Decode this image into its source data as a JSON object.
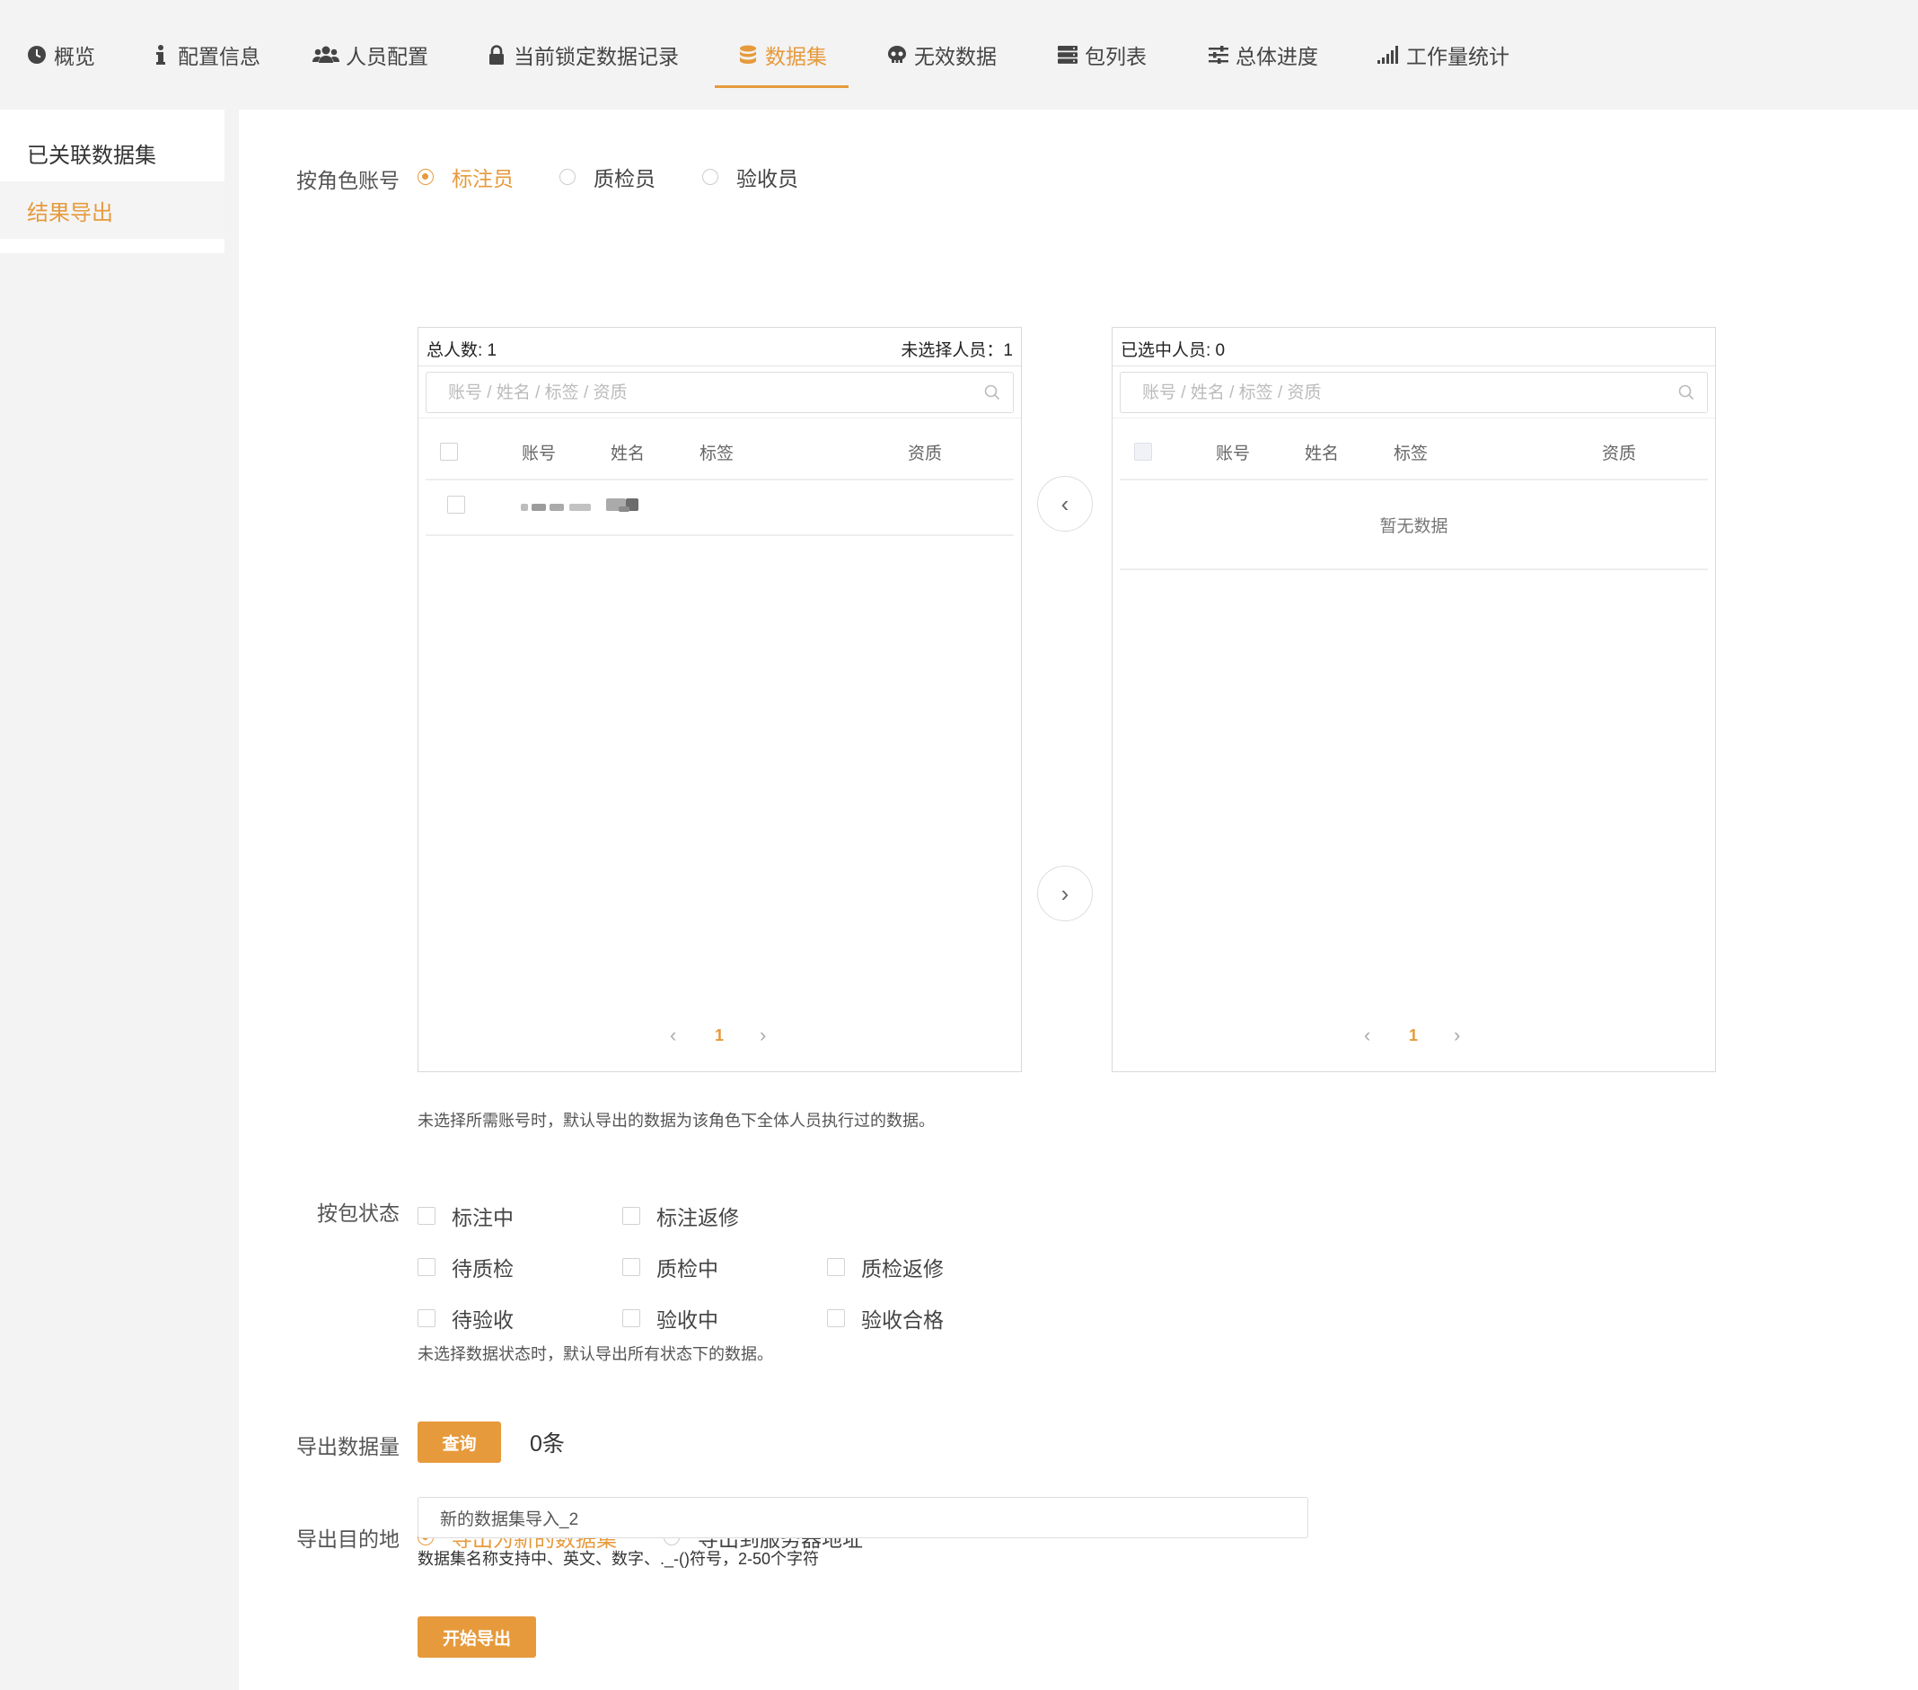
{
  "nav": {
    "tabs": [
      {
        "label": "概览",
        "icon": "clock-icon"
      },
      {
        "label": "配置信息",
        "icon": "info-icon"
      },
      {
        "label": "人员配置",
        "icon": "users-icon"
      },
      {
        "label": "当前锁定数据记录",
        "icon": "lock-icon"
      },
      {
        "label": "数据集",
        "icon": "database-icon",
        "active": true
      },
      {
        "label": "无效数据",
        "icon": "skull-icon"
      },
      {
        "label": "包列表",
        "icon": "server-list-icon"
      },
      {
        "label": "总体进度",
        "icon": "sliders-icon"
      },
      {
        "label": "工作量统计",
        "icon": "signal-bars-icon"
      }
    ]
  },
  "sidebar": {
    "items": [
      {
        "label": "已关联数据集",
        "active": false
      },
      {
        "label": "结果导出",
        "active": true
      }
    ]
  },
  "role_filter": {
    "label": "按角色账号",
    "options": [
      {
        "label": "标注员",
        "selected": true
      },
      {
        "label": "质检员",
        "selected": false
      },
      {
        "label": "验收员",
        "selected": false
      }
    ]
  },
  "left_panel": {
    "total": "总人数: 1",
    "unselected": "未选择人员：1",
    "search_placeholder": "账号 / 姓名 / 标签 / 资质",
    "columns": [
      "账号",
      "姓名",
      "标签",
      "资质"
    ],
    "rows_count": 1,
    "page": "1"
  },
  "right_panel": {
    "selected": "已选中人员: 0",
    "search_placeholder": "账号 / 姓名 / 标签 / 资质",
    "columns": [
      "账号",
      "姓名",
      "标签",
      "资质"
    ],
    "empty": "暂无数据",
    "page": "1"
  },
  "transfer": {
    "left_arrow": "‹",
    "right_arrow": "›"
  },
  "role_note": "未选择所需账号时，默认导出的数据为该角色下全体人员执行过的数据。",
  "status_filter": {
    "label": "按包状态",
    "rows": [
      [
        "标注中",
        "标注返修"
      ],
      [
        "待质检",
        "质检中",
        "质检返修"
      ],
      [
        "待验收",
        "验收中",
        "验收合格"
      ]
    ],
    "note": "未选择数据状态时，默认导出所有状态下的数据。"
  },
  "export_count": {
    "label": "导出数据量",
    "button": "查询",
    "value": "0条"
  },
  "destination": {
    "label": "导出目的地",
    "options": [
      {
        "label": "导出为新的数据集",
        "selected": true
      },
      {
        "label": "导出到服务器地址",
        "selected": false
      }
    ],
    "input_value": "新的数据集导入_2",
    "hint": "数据集名称支持中、英文、数字、._-()符号，2-50个字符"
  },
  "start_button": "开始导出",
  "colors": {
    "accent": "#e69a3c",
    "border": "#d9d9d9",
    "bg": "#f3f3f3"
  }
}
